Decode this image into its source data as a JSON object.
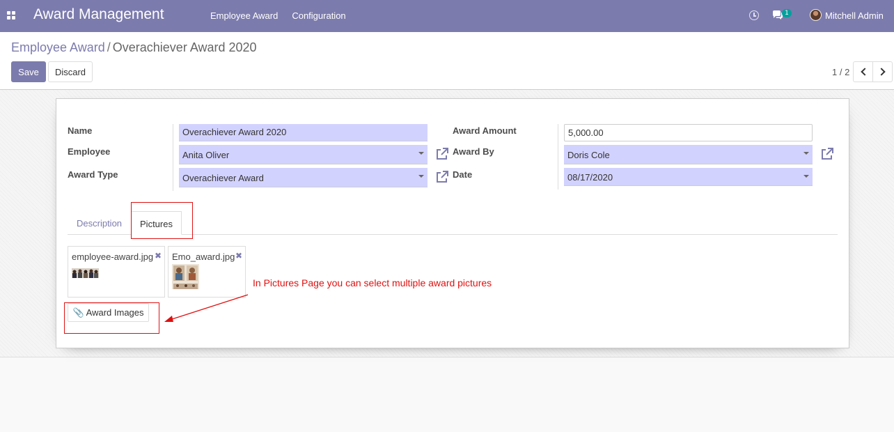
{
  "navbar": {
    "app_title": "Award Management",
    "menu": [
      "Employee Award",
      "Configuration"
    ],
    "chat_count": "1",
    "user_name": "Mitchell Admin",
    "color": "#7c7bad"
  },
  "breadcrumb": {
    "parent": "Employee Award",
    "separator": "/",
    "current": "Overachiever Award 2020"
  },
  "buttons": {
    "save": "Save",
    "discard": "Discard"
  },
  "pager": {
    "value": "1 / 2"
  },
  "form": {
    "name_label": "Name",
    "name_value": "Overachiever Award 2020",
    "employee_label": "Employee",
    "employee_value": "Anita Oliver",
    "award_type_label": "Award Type",
    "award_type_value": "Overachiever Award",
    "award_amount_label": "Award Amount",
    "award_amount_value": "5,000.00",
    "award_by_label": "Award By",
    "award_by_value": "Doris Cole",
    "date_label": "Date",
    "date_value": "08/17/2020"
  },
  "tabs": {
    "description": "Description",
    "pictures": "Pictures",
    "active": "Pictures"
  },
  "attachments": [
    {
      "name": "employee-award.jpg"
    },
    {
      "name": "Emo_award.jpg"
    }
  ],
  "award_images_button": "Award Images",
  "annotation": "In Pictures Page you can select multiple award pictures",
  "icons": {
    "apps": "apps-grid-icon",
    "clock": "clock-icon",
    "chat": "chat-icon",
    "external": "external-link-icon",
    "remove": "remove-x-icon",
    "paperclip": "paperclip-icon"
  },
  "colors": {
    "accent": "#7c7bad",
    "required_field": "#d2d2ff",
    "annotation": "#e01010",
    "badge": "#00a09d"
  }
}
